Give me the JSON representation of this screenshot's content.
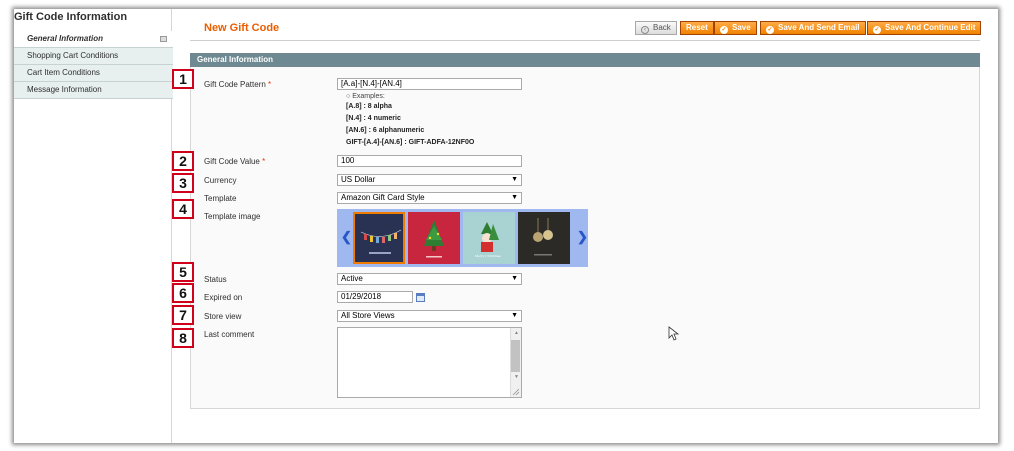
{
  "sidebar": {
    "title": "Gift Code Information",
    "items": [
      {
        "label": "General Information",
        "active": true
      },
      {
        "label": "Shopping Cart Conditions"
      },
      {
        "label": "Cart Item Conditions"
      },
      {
        "label": "Message Information"
      }
    ]
  },
  "header": {
    "title": "New Gift Code",
    "buttons": {
      "back": "Back",
      "reset": "Reset",
      "save": "Save",
      "save_send": "Save And Send Email",
      "save_continue": "Save And Continue Edit"
    }
  },
  "section": {
    "title": "General Information"
  },
  "form": {
    "pattern": {
      "label": "Gift Code Pattern",
      "required": "*",
      "value": "[A.a]-[N.4]-[AN.4]",
      "examples_title": "Examples:",
      "examples": [
        {
          "code": "[A.8]",
          "desc": ": 8 alpha"
        },
        {
          "code": "[N.4]",
          "desc": ": 4 numeric"
        },
        {
          "code": "[AN.6]",
          "desc": ": 6 alphanumeric"
        },
        {
          "code": "GIFT-[A.4]-[AN.6]",
          "desc": ": GIFT-ADFA-12NF0O"
        }
      ]
    },
    "value": {
      "label": "Gift Code Value",
      "required": "*",
      "value": "100"
    },
    "currency": {
      "label": "Currency",
      "value": "US Dollar"
    },
    "template": {
      "label": "Template",
      "value": "Amazon Gift Card Style"
    },
    "template_image": {
      "label": "Template image",
      "thumb3_text": "Merry Christmas"
    },
    "status": {
      "label": "Status",
      "value": "Active"
    },
    "expired": {
      "label": "Expired on",
      "value": "01/29/2018"
    },
    "store_view": {
      "label": "Store view",
      "value": "All Store Views"
    },
    "last_comment": {
      "label": "Last comment",
      "value": ""
    }
  },
  "callouts": [
    "1",
    "2",
    "3",
    "4",
    "5",
    "6",
    "7",
    "8"
  ],
  "colors": {
    "accent": "#eb5e00",
    "button": "#f18200",
    "section_header": "#6f8992",
    "callout": "#d0021b"
  }
}
